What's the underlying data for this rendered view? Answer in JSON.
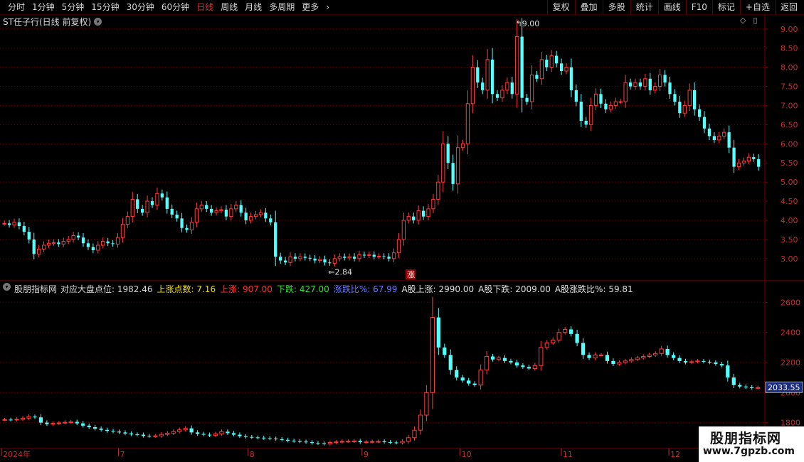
{
  "toolbar": {
    "periods": [
      "分时",
      "1分钟",
      "5分钟",
      "15分钟",
      "30分钟",
      "60分钟",
      "日线",
      "周线",
      "月线",
      "多周期",
      "更多"
    ],
    "active_period": "日线",
    "right_buttons": [
      "复权",
      "叠加",
      "多股",
      "统计",
      "画线",
      "F10",
      "标记",
      "+自选",
      "返回"
    ]
  },
  "main_panel": {
    "title": "ST任子行(日线 前复权)",
    "price_axis": [
      "9.00",
      "8.50",
      "8.00",
      "7.50",
      "7.00",
      "6.50",
      "6.00",
      "5.50",
      "5.00",
      "4.50",
      "4.00",
      "3.50",
      "3.00"
    ],
    "high_marker": "9.00",
    "low_marker": "2.84",
    "signal_label": "涨"
  },
  "indicator_panel": {
    "name": "股朋指标网",
    "items": [
      {
        "label": "对应大盘点位:",
        "value": "1982.46",
        "color": "#d8d8d8"
      },
      {
        "label": "上涨点数:",
        "value": "7.16",
        "color": "#f0e000"
      },
      {
        "label": "上涨:",
        "value": "907.00",
        "color": "#ff3030"
      },
      {
        "label": "下跌:",
        "value": "427.00",
        "color": "#30e030"
      },
      {
        "label": "涨跌比%:",
        "value": "67.99",
        "color": "#6a7aff"
      },
      {
        "label": "A股上涨:",
        "value": "2990.00",
        "color": "#e0e0e0"
      },
      {
        "label": "A股下跌:",
        "value": "2009.00",
        "color": "#e0e0e0"
      },
      {
        "label": "A股涨跌比%:",
        "value": "59.81",
        "color": "#e0e0e0"
      }
    ],
    "value_axis": [
      "2600",
      "2400",
      "2200",
      "2000",
      "1800"
    ],
    "current_value": "2033.55"
  },
  "time_axis": [
    "2024年",
    "7",
    "8",
    "9",
    "10",
    "11",
    "12"
  ],
  "watermark": {
    "title": "股朋指标网",
    "url": "www.7gpzb.com"
  },
  "colors": {
    "up": "#ff3c3c",
    "down": "#54ffff",
    "grid": "#6a0000",
    "frame": "#7a0000"
  },
  "chart_data": [
    {
      "type": "candlestick",
      "title": "ST任子行(日线 前复权)",
      "ylim": [
        2.7,
        9.2
      ],
      "yticks": [
        9.0,
        8.5,
        8.0,
        7.5,
        7.0,
        6.5,
        6.0,
        5.5,
        5.0,
        4.5,
        4.0,
        3.5,
        3.0
      ],
      "annotations": [
        {
          "text": "9.00",
          "value": 9.0
        },
        {
          "text": "2.84",
          "value": 2.84
        }
      ],
      "close": [
        3.92,
        3.88,
        3.95,
        3.85,
        3.7,
        3.5,
        3.12,
        3.25,
        3.35,
        3.4,
        3.42,
        3.38,
        3.45,
        3.5,
        3.6,
        3.55,
        3.4,
        3.3,
        3.22,
        3.35,
        3.45,
        3.4,
        3.38,
        3.55,
        3.9,
        4.1,
        4.55,
        4.3,
        4.2,
        4.5,
        4.4,
        4.7,
        4.6,
        4.3,
        4.15,
        4.05,
        3.8,
        3.75,
        3.95,
        4.3,
        4.4,
        4.3,
        4.2,
        4.25,
        4.28,
        4.1,
        4.3,
        4.4,
        4.2,
        4.0,
        4.1,
        4.15,
        4.2,
        4.05,
        3.95,
        3.05,
        2.95,
        2.9,
        3.05,
        3.0,
        3.05,
        3.02,
        3.0,
        2.95,
        2.98,
        2.9,
        2.88,
        3.0,
        3.05,
        3.02,
        3.05,
        3.0,
        3.1,
        3.08,
        3.1,
        3.05,
        3.06,
        3.05,
        3.0,
        3.15,
        3.5,
        4.0,
        4.1,
        4.0,
        4.25,
        4.1,
        4.3,
        4.55,
        5.0,
        6.0,
        5.5,
        4.95,
        5.9,
        6.0,
        7.05,
        8.0,
        7.6,
        7.4,
        8.2,
        7.3,
        7.2,
        7.4,
        7.6,
        7.3,
        8.8,
        7.2,
        7.1,
        7.8,
        7.7,
        8.2,
        8.0,
        8.3,
        8.1,
        7.9,
        8.0,
        7.4,
        7.1,
        6.6,
        6.5,
        7.0,
        7.3,
        7.05,
        6.9,
        7.0,
        7.1,
        7.1,
        7.6,
        7.5,
        7.6,
        7.5,
        7.7,
        7.4,
        7.5,
        7.8,
        7.6,
        7.3,
        7.1,
        6.8,
        7.0,
        7.4,
        6.9,
        6.7,
        6.4,
        6.2,
        6.1,
        6.2,
        6.3,
        5.9,
        5.4,
        5.5,
        5.55,
        5.65,
        5.6,
        5.4
      ]
    },
    {
      "type": "candlestick",
      "title": "股朋指标网",
      "ylim": [
        1680,
        2720
      ],
      "yticks": [
        2600,
        2400,
        2200,
        2000,
        1800
      ],
      "close": [
        1820,
        1818,
        1822,
        1830,
        1840,
        1835,
        1800,
        1790,
        1795,
        1798,
        1802,
        1805,
        1795,
        1780,
        1770,
        1760,
        1752,
        1745,
        1740,
        1735,
        1728,
        1722,
        1720,
        1712,
        1710,
        1712,
        1722,
        1730,
        1740,
        1752,
        1762,
        1735,
        1725,
        1720,
        1715,
        1725,
        1740,
        1730,
        1720,
        1710,
        1705,
        1702,
        1700,
        1696,
        1694,
        1690,
        1686,
        1680,
        1677,
        1674,
        1670,
        1665,
        1662,
        1660,
        1668,
        1672,
        1675,
        1676,
        1678,
        1670,
        1672,
        1674,
        1675,
        1671,
        1668,
        1666,
        1675,
        1700,
        1750,
        1850,
        2000,
        2500,
        2300,
        2250,
        2150,
        2100,
        2080,
        2060,
        2050,
        2150,
        2240,
        2220,
        2230,
        2210,
        2200,
        2180,
        2170,
        2160,
        2180,
        2300,
        2330,
        2350,
        2400,
        2420,
        2390,
        2330,
        2250,
        2230,
        2250,
        2250,
        2210,
        2190,
        2200,
        2210,
        2220,
        2230,
        2240,
        2250,
        2260,
        2290,
        2250,
        2230,
        2210,
        2200,
        2205,
        2210,
        2205,
        2200,
        2190,
        2180,
        2100,
        2050,
        2040,
        2035,
        2030,
        2033
      ]
    }
  ]
}
